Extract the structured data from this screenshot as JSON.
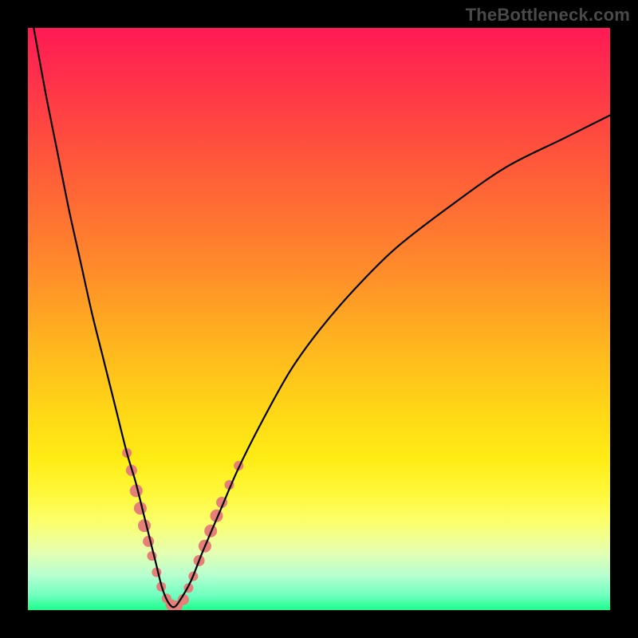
{
  "watermark": {
    "text": "TheBottleneck.com"
  },
  "chart_data": {
    "type": "line",
    "title": "",
    "xlabel": "",
    "ylabel": "",
    "xlim": [
      0,
      100
    ],
    "ylim": [
      0,
      100
    ],
    "grid": false,
    "series": [
      {
        "name": "bottleneck-curve",
        "x": [
          1,
          3,
          5,
          7,
          9,
          11,
          13,
          15,
          17,
          18.5,
          20,
          21,
          22,
          23,
          24,
          25,
          26,
          28,
          30,
          33,
          36,
          40,
          45,
          50,
          56,
          63,
          72,
          82,
          92,
          100
        ],
        "values": [
          100,
          89,
          79,
          69,
          60,
          51,
          43,
          35,
          27,
          22,
          16,
          12,
          8,
          4,
          1.5,
          0.5,
          1.5,
          5,
          10,
          17,
          24,
          32,
          41,
          48,
          55,
          62,
          69,
          76,
          81,
          85
        ],
        "color": "#000000",
        "width": 2.2
      }
    ],
    "markers": [
      {
        "name": "highlight-dots",
        "color": "#e57f78",
        "points": [
          {
            "x": 17.0,
            "y": 27.0,
            "r": 6
          },
          {
            "x": 17.8,
            "y": 24.0,
            "r": 7
          },
          {
            "x": 18.6,
            "y": 20.5,
            "r": 8
          },
          {
            "x": 19.3,
            "y": 17.5,
            "r": 8
          },
          {
            "x": 20.0,
            "y": 14.5,
            "r": 8
          },
          {
            "x": 20.7,
            "y": 11.8,
            "r": 7
          },
          {
            "x": 21.3,
            "y": 9.3,
            "r": 6
          },
          {
            "x": 22.1,
            "y": 6.5,
            "r": 6
          },
          {
            "x": 22.9,
            "y": 4.0,
            "r": 6
          },
          {
            "x": 23.8,
            "y": 2.0,
            "r": 6
          },
          {
            "x": 24.6,
            "y": 0.9,
            "r": 7
          },
          {
            "x": 25.6,
            "y": 0.7,
            "r": 7
          },
          {
            "x": 26.7,
            "y": 1.8,
            "r": 7
          },
          {
            "x": 27.6,
            "y": 3.8,
            "r": 6
          },
          {
            "x": 28.4,
            "y": 5.8,
            "r": 6
          },
          {
            "x": 29.4,
            "y": 8.5,
            "r": 7
          },
          {
            "x": 30.4,
            "y": 11.0,
            "r": 8
          },
          {
            "x": 31.4,
            "y": 13.6,
            "r": 8
          },
          {
            "x": 32.4,
            "y": 16.2,
            "r": 8
          },
          {
            "x": 33.3,
            "y": 18.5,
            "r": 7
          },
          {
            "x": 34.6,
            "y": 21.5,
            "r": 6
          },
          {
            "x": 36.2,
            "y": 24.8,
            "r": 6
          }
        ]
      }
    ]
  }
}
